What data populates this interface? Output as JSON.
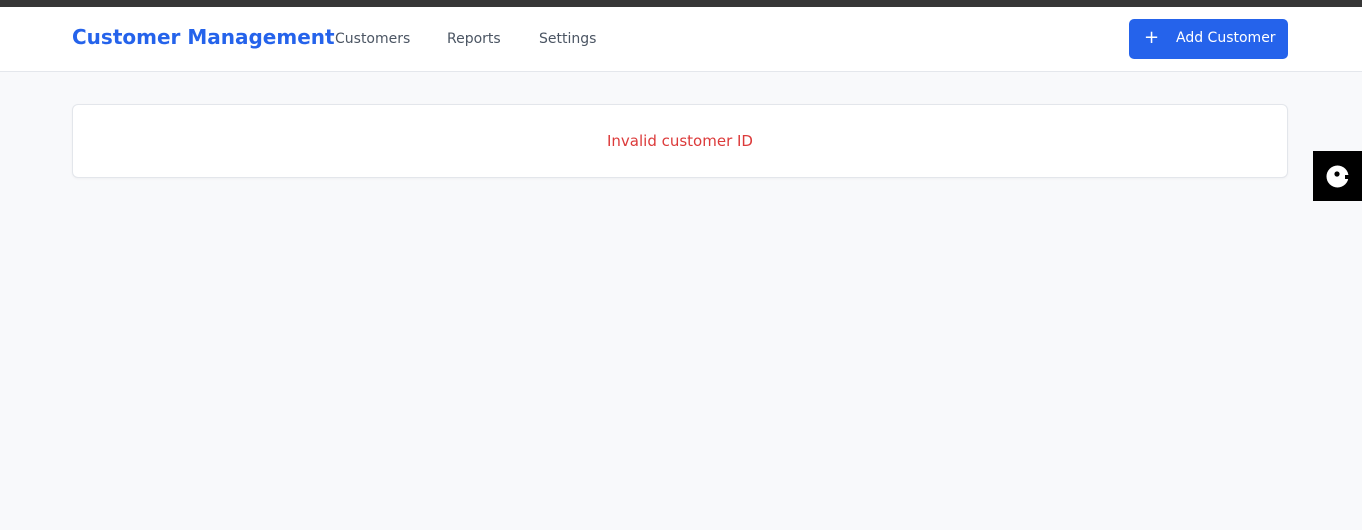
{
  "header": {
    "brand": "Customer Management",
    "nav": [
      "Customers",
      "Reports",
      "Settings"
    ],
    "add_button": {
      "icon": "+",
      "label": "Add Customer"
    }
  },
  "main": {
    "error_message": "Invalid customer ID"
  },
  "colors": {
    "accent": "#2563eb",
    "error": "#dc3a3a",
    "background": "#f8f9fb"
  },
  "widget": {
    "icon": "feedback-bubble-icon"
  }
}
